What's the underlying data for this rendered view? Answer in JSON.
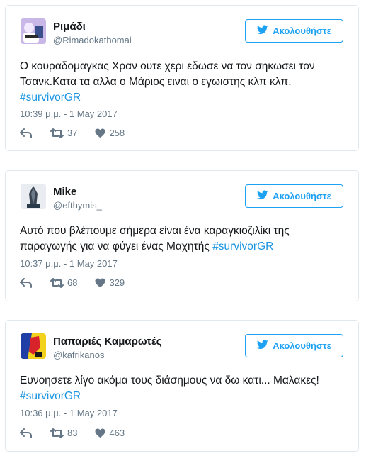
{
  "tweets": [
    {
      "name": "Ριμάδι",
      "handle": "@Rimadokathomai",
      "follow_label": "Ακολουθήστε",
      "text": "Ο κουραδομαγκας Χραν ουτε χερι εδωσε να τον σηκωσει τον Τσανκ.Κατα τα αλλα ο Μάριος ειναι ο εγωιστης κλπ κλπ.",
      "hashtag": "#survivorGR",
      "timestamp": "10:39 μ.μ. - 1 May 2017",
      "retweets": "37",
      "likes": "258"
    },
    {
      "name": "Mike",
      "handle": "@efthymis_",
      "follow_label": "Ακολουθήστε",
      "text": "Αυτό που βλέπουμε σήμερα είναι ένα καραγκιοζιλίκι της παραγωγής για να φύγει ένας Μαχητής",
      "hashtag": "#survivorGR",
      "timestamp": "10:37 μ.μ. - 1 May 2017",
      "retweets": "68",
      "likes": "329"
    },
    {
      "name": "Παπαριές Καμαρωτές",
      "handle": "@kafrikanos",
      "follow_label": "Ακολουθήστε",
      "text": "Ευνοησετε λίγο ακόμα τους διάσημους να δω κατι... Μαλακες!",
      "hashtag": "#survivorGR",
      "timestamp": "10:36 μ.μ. - 1 May 2017",
      "retweets": "83",
      "likes": "463"
    }
  ],
  "colors": {
    "accent": "#1da1f2",
    "hashtag": "#1b95e0",
    "muted": "#657786",
    "border": "#e1e8ed"
  },
  "icons": [
    "twitter-bird-icon",
    "reply-icon",
    "retweet-icon",
    "heart-icon"
  ]
}
